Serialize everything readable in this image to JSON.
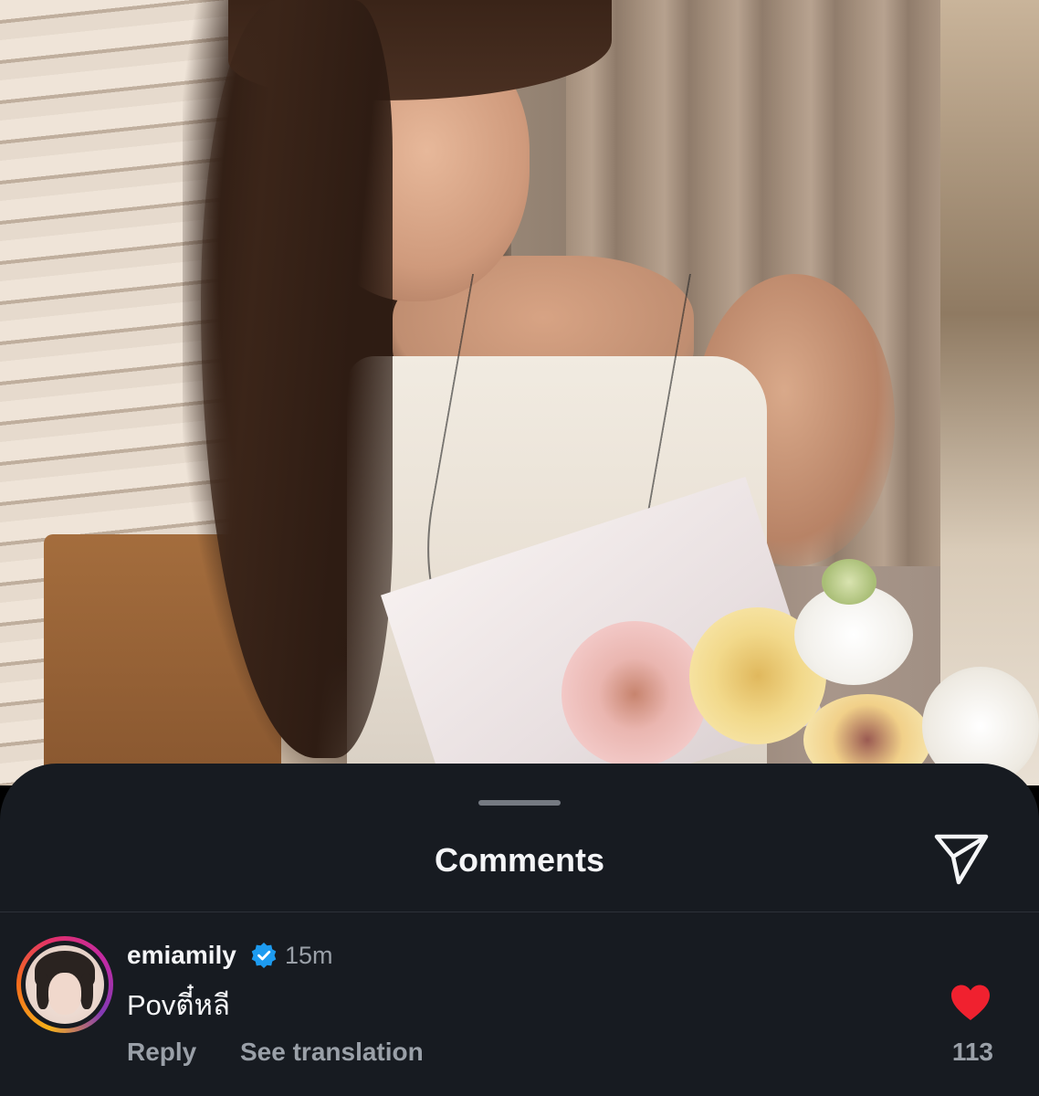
{
  "sheet": {
    "title": "Comments"
  },
  "icons": {
    "send": "send-icon",
    "verified": "verified-badge-icon",
    "like": "heart-filled-icon"
  },
  "colors": {
    "sheet_background": "#171b21",
    "like_red": "#f0212f",
    "verified_blue": "#1d9bf0",
    "secondary_text": "#9aa0a8"
  },
  "comment": {
    "username": "emiamily",
    "verified": true,
    "time": "15m",
    "text": "Povตี๋หลี",
    "reply_label": "Reply",
    "translate_label": "See translation",
    "liked": true,
    "like_count": "113"
  }
}
